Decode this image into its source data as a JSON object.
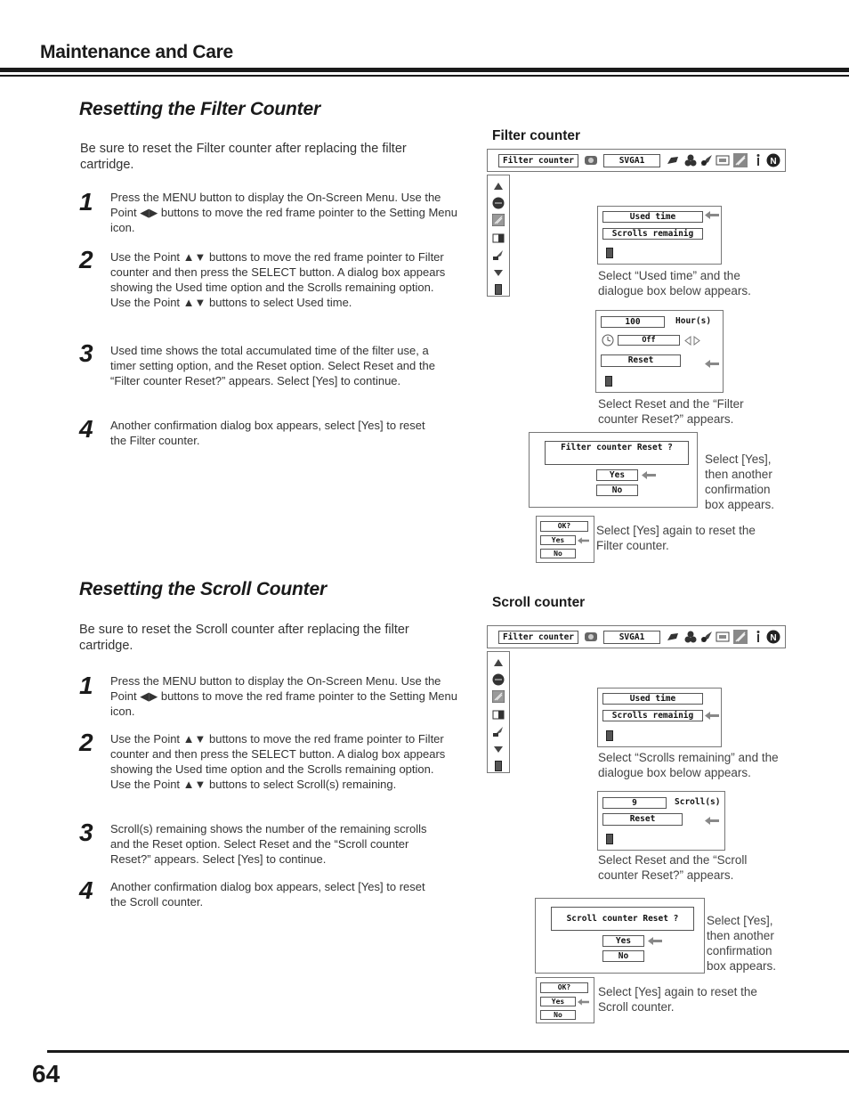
{
  "header": {
    "title": "Maintenance and Care"
  },
  "filter_section": {
    "title": "Resetting the Filter Counter",
    "intro": "Be sure to reset the Filter counter after replacing the filter cartridge.",
    "steps": [
      {
        "num": "1",
        "text": "Press the MENU button to display the On-Screen Menu. Use the Point ◀▶ buttons to move the red frame pointer to the Setting Menu icon."
      },
      {
        "num": "2",
        "text": "Use the Point ▲▼ buttons to move the red frame pointer to Filter counter and then press the SELECT button. A dialog box appears showing the Used time option and the Scrolls remaining option. Use the Point ▲▼ buttons to select Used time."
      },
      {
        "num": "3",
        "text": "Used time shows the total accumulated time of the filter use, a timer setting option, and the Reset option. Select Reset and the “Filter counter Reset?” appears. Select [Yes] to continue."
      },
      {
        "num": "4",
        "text": "Another confirmation dialog box appears, select [Yes] to reset the Filter counter."
      }
    ],
    "figure": {
      "label": "Filter counter",
      "toolbar": {
        "menu_field": "Filter counter",
        "source_field": "SVGA1"
      },
      "dialog1": {
        "opt1": "Used time",
        "opt2": "Scrolls remainig",
        "caption": "Select “Used time” and the dialogue box below appears."
      },
      "dialog2": {
        "value": "100",
        "unit": "Hour(s)",
        "timer": "Off",
        "reset": "Reset",
        "caption": "Select Reset and the “Filter counter Reset?” appears."
      },
      "dialog3": {
        "question": "Filter counter Reset ?",
        "yes": "Yes",
        "no": "No",
        "caption": "Select [Yes], then another confirmation box appears."
      },
      "dialog4": {
        "ok": "OK?",
        "yes": "Yes",
        "no": "No",
        "caption": "Select [Yes] again to reset the Filter counter."
      }
    }
  },
  "scroll_section": {
    "title": "Resetting the Scroll Counter",
    "intro": "Be sure to reset the Scroll counter after replacing the filter cartridge.",
    "steps": [
      {
        "num": "1",
        "text": "Press the MENU button to display the On-Screen Menu. Use the Point ◀▶ buttons to move the red frame pointer to the Setting Menu icon."
      },
      {
        "num": "2",
        "text": "Use the Point ▲▼ buttons to move the red frame pointer to Filter counter and then press the SELECT button. A dialog box appears showing the Used time option and the Scrolls remaining option. Use the Point ▲▼ buttons to select Scroll(s) remaining."
      },
      {
        "num": "3",
        "text": "Scroll(s) remaining shows the number of the remaining scrolls and the Reset option. Select Reset and the “Scroll counter Reset?” appears. Select [Yes] to continue."
      },
      {
        "num": "4",
        "text": "Another confirmation dialog box appears, select [Yes] to reset the Scroll counter."
      }
    ],
    "figure": {
      "label": "Scroll counter",
      "toolbar": {
        "menu_field": "Filter counter",
        "source_field": "SVGA1"
      },
      "dialog1": {
        "opt1": "Used time",
        "opt2": "Scrolls remainig",
        "caption": "Select “Scrolls remaining” and the dialogue box below appears."
      },
      "dialog2": {
        "value": "9",
        "unit": "Scroll(s)",
        "reset": "Reset",
        "caption": "Select Reset and the “Scroll counter Reset?” appears."
      },
      "dialog3": {
        "question": "Scroll counter Reset ?",
        "yes": "Yes",
        "no": "No",
        "caption": "Select [Yes], then another confirmation box appears."
      },
      "dialog4": {
        "ok": "OK?",
        "yes": "Yes",
        "no": "No",
        "caption": "Select [Yes] again to reset the Scroll counter."
      }
    }
  },
  "footer": {
    "page_number": "64"
  }
}
